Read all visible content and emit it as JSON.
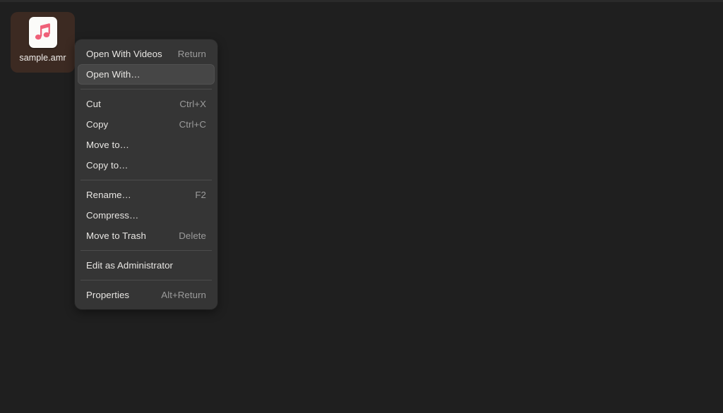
{
  "desktop": {
    "background_color": "#1f1f1f",
    "top_strip_color": "#2a2a2a"
  },
  "file_icon": {
    "name": "sample.amr",
    "icon": "music-note-icon",
    "selection_color": "#3c2a22",
    "thumb_color": "#fbfbf9",
    "note_color": "#ef6179"
  },
  "context_menu": {
    "background_color": "#353535",
    "highlight_color": "#464646",
    "sections": [
      {
        "items": [
          {
            "label": "Open With Videos",
            "accel": "Return",
            "highlighted": false
          },
          {
            "label": "Open With…",
            "accel": "",
            "highlighted": true
          }
        ]
      },
      {
        "items": [
          {
            "label": "Cut",
            "accel": "Ctrl+X",
            "highlighted": false
          },
          {
            "label": "Copy",
            "accel": "Ctrl+C",
            "highlighted": false
          },
          {
            "label": "Move to…",
            "accel": "",
            "highlighted": false
          },
          {
            "label": "Copy to…",
            "accel": "",
            "highlighted": false
          }
        ]
      },
      {
        "items": [
          {
            "label": "Rename…",
            "accel": "F2",
            "highlighted": false
          },
          {
            "label": "Compress…",
            "accel": "",
            "highlighted": false
          },
          {
            "label": "Move to Trash",
            "accel": "Delete",
            "highlighted": false
          }
        ]
      },
      {
        "items": [
          {
            "label": "Edit as Administrator",
            "accel": "",
            "highlighted": false
          }
        ]
      },
      {
        "items": [
          {
            "label": "Properties",
            "accel": "Alt+Return",
            "highlighted": false
          }
        ]
      }
    ]
  }
}
